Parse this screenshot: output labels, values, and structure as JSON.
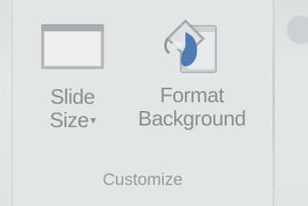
{
  "ribbon_group": {
    "title": "Customize",
    "commands": {
      "slide_size": {
        "line1": "Slide",
        "line2": "Size",
        "has_dropdown": true,
        "icon": "slide-size-icon"
      },
      "format_background": {
        "line1": "Format",
        "line2": "Background",
        "icon": "format-background-icon"
      }
    }
  },
  "colors": {
    "ribbon_bg": "#e3e4e4",
    "label_text": "#8d8e8f",
    "icon_blue": "#5b87b8",
    "icon_gray": "#b9babc"
  }
}
